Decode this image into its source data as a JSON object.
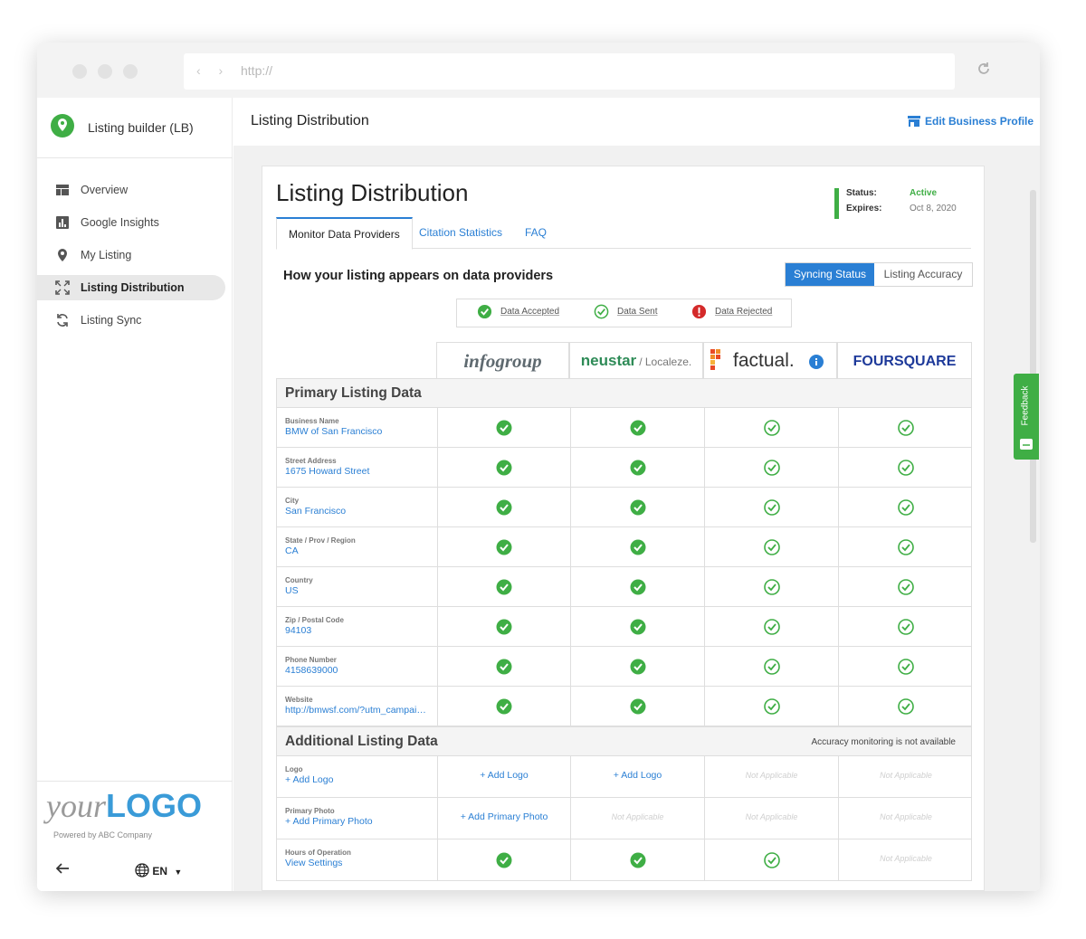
{
  "browser": {
    "url_placeholder": "http://"
  },
  "app": {
    "name": "Listing builder (LB)"
  },
  "sidebar": {
    "items": [
      {
        "label": "Overview",
        "icon": "dashboard-icon"
      },
      {
        "label": "Google Insights",
        "icon": "bar-chart-icon"
      },
      {
        "label": "My Listing",
        "icon": "location-pin-icon"
      },
      {
        "label": "Listing Distribution",
        "icon": "expand-icon",
        "active": true
      },
      {
        "label": "Listing Sync",
        "icon": "sync-icon"
      }
    ]
  },
  "footer": {
    "logo_your": "your",
    "logo_big": "LOGO",
    "powered": "Powered by ABC Company",
    "lang": "EN"
  },
  "topbar": {
    "title": "Listing Distribution",
    "edit_label": "Edit Business Profile"
  },
  "page": {
    "title": "Listing Distribution",
    "status_label": "Status:",
    "status_value": "Active",
    "expires_label": "Expires:",
    "expires_value": "Oct 8, 2020",
    "tabs": [
      "Monitor Data Providers",
      "Citation Statistics",
      "FAQ"
    ],
    "section_title": "How your listing appears on data providers",
    "toggle": [
      "Syncing Status",
      "Listing Accuracy"
    ],
    "legend": [
      "Data Accepted",
      "Data Sent",
      "Data Rejected"
    ]
  },
  "providers": [
    {
      "name": "infogroup",
      "color": "#5f6a70"
    },
    {
      "name": "neustar",
      "suffix": "/ Localeze.",
      "color": "#2e8b57"
    },
    {
      "name": "factual.",
      "color": "#333333"
    },
    {
      "name": "FOURSQUARE",
      "color": "#1e3a9a"
    }
  ],
  "primary": {
    "title": "Primary Listing Data",
    "rows": [
      {
        "label": "Business Name",
        "value": "BMW of San Francisco"
      },
      {
        "label": "Street Address",
        "value": "1675 Howard Street"
      },
      {
        "label": "City",
        "value": "San Francisco"
      },
      {
        "label": "State / Prov / Region",
        "value": "CA"
      },
      {
        "label": "Country",
        "value": "US"
      },
      {
        "label": "Zip / Postal Code",
        "value": "94103"
      },
      {
        "label": "Phone Number",
        "value": "4158639000"
      },
      {
        "label": "Website",
        "value": "http://bmwsf.com/?utm_campaign=..."
      }
    ]
  },
  "additional": {
    "title": "Additional Listing Data",
    "note": "Accuracy monitoring is not available",
    "rows": [
      {
        "label": "Logo",
        "value": "+ Add Logo",
        "cells": [
          {
            "t": "add",
            "v": "+ Add Logo"
          },
          {
            "t": "add",
            "v": "+ Add Logo"
          },
          {
            "t": "na",
            "v": "Not Applicable"
          },
          {
            "t": "na",
            "v": "Not Applicable"
          }
        ]
      },
      {
        "label": "Primary Photo",
        "value": "+ Add Primary Photo",
        "cells": [
          {
            "t": "add",
            "v": "+ Add Primary Photo"
          },
          {
            "t": "na",
            "v": "Not Applicable"
          },
          {
            "t": "na",
            "v": "Not Applicable"
          },
          {
            "t": "na",
            "v": "Not Applicable"
          }
        ]
      },
      {
        "label": "Hours of Operation",
        "value": "View Settings",
        "cells": [
          {
            "t": "accepted"
          },
          {
            "t": "accepted"
          },
          {
            "t": "sent"
          },
          {
            "t": "na",
            "v": "Not Applicable"
          }
        ]
      }
    ]
  },
  "feedback_label": "Feedback",
  "colors": {
    "accent": "#2a7fd4",
    "green": "#3fae45",
    "red": "#d42a2a"
  }
}
